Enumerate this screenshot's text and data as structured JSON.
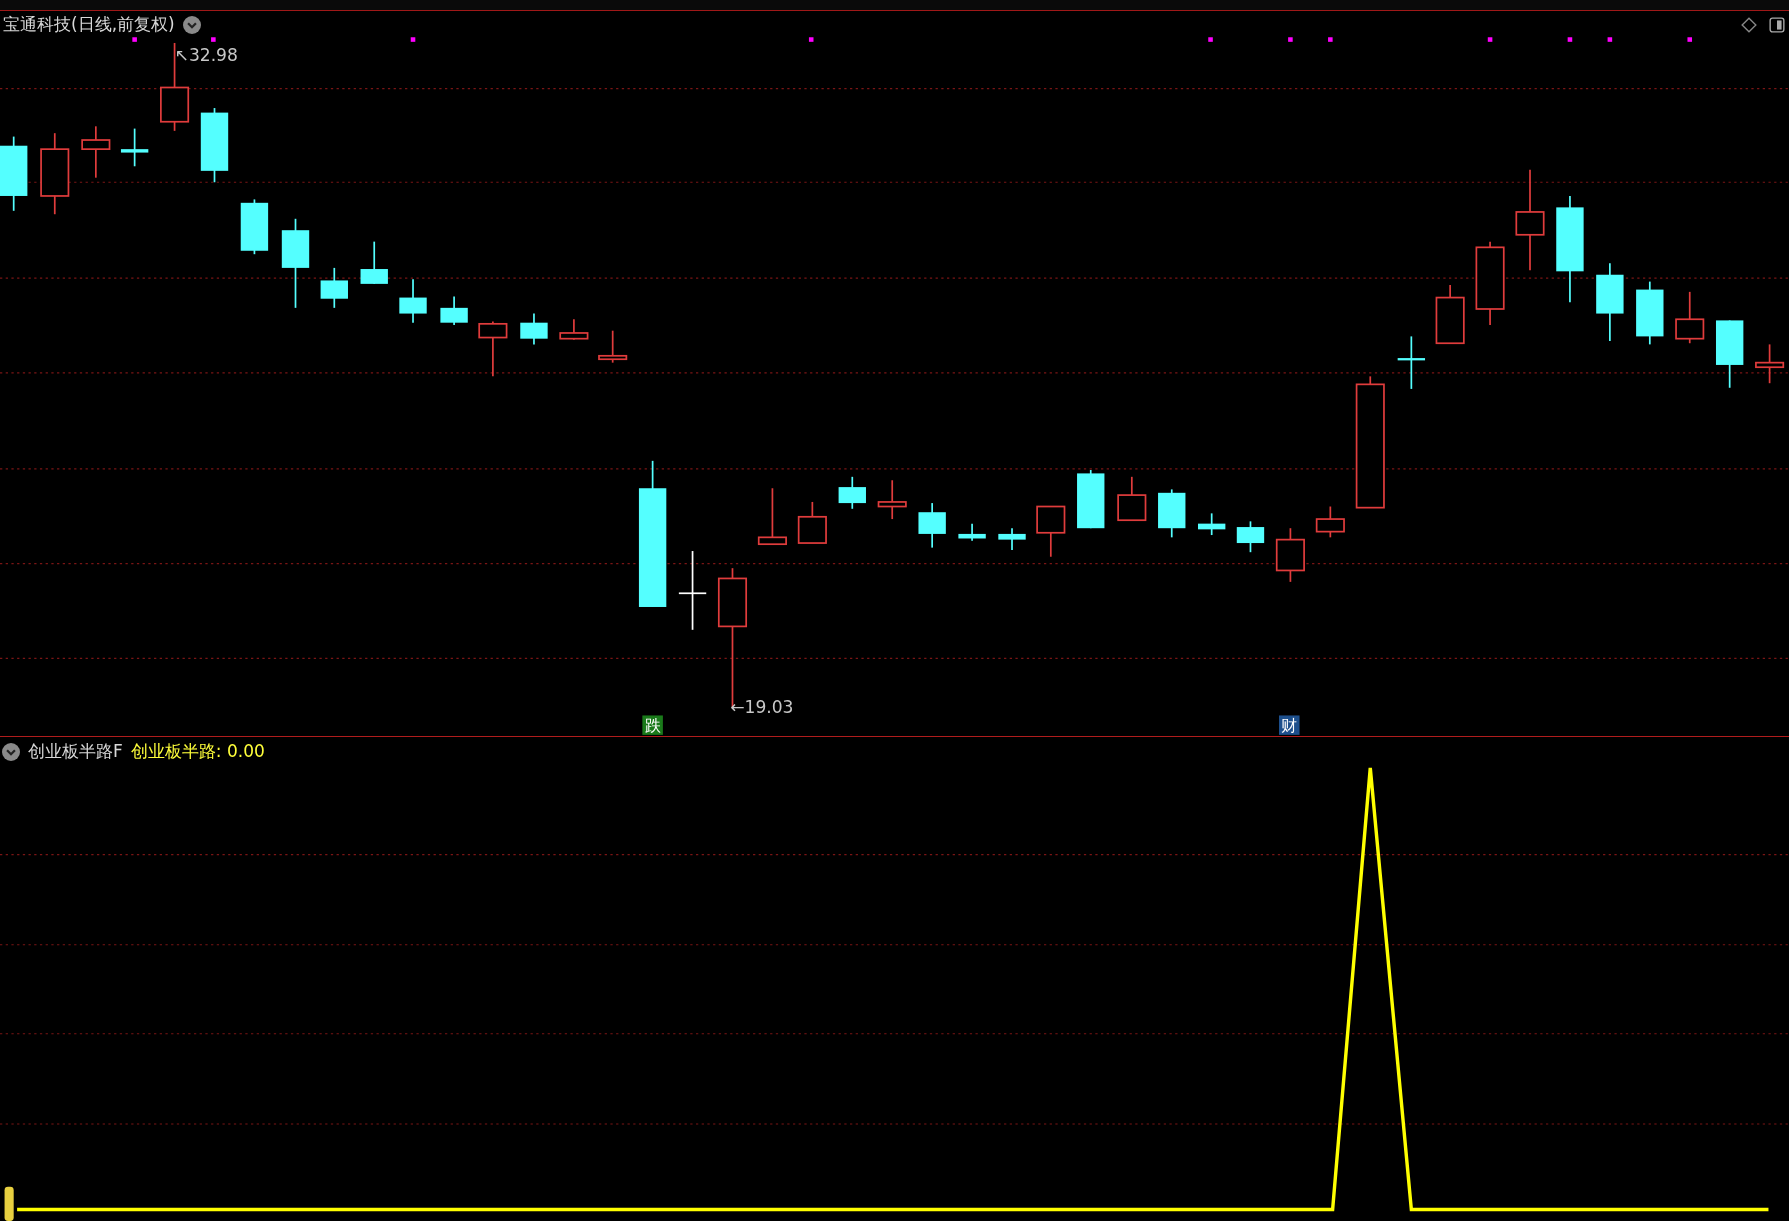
{
  "price_chart": {
    "title": "宝通科技(日线,前复权)",
    "high_label": "↖32.98",
    "low_label": "←19.03",
    "signals": [
      {
        "text": "跌",
        "color": "#1a7a1a"
      },
      {
        "text": "财",
        "color": "#1d4f8c"
      }
    ]
  },
  "indicator": {
    "name": "创业板半路F",
    "value_label": "创业板半路: 0.00"
  }
}
